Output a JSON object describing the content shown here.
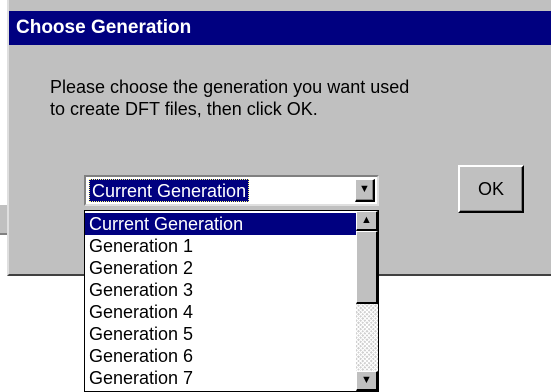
{
  "dialog": {
    "title": "Choose Generation",
    "message": "Please choose the generation you want used\nto create DFT files, then click OK.",
    "ok_label": "OK"
  },
  "combo": {
    "selected_value": "Current Generation",
    "options": [
      "Current Generation",
      "Generation 1",
      "Generation 2",
      "Generation 3",
      "Generation 4",
      "Generation 5",
      "Generation 6",
      "Generation 7"
    ],
    "highlighted_index": 0
  },
  "icons": {
    "combo_arrow": "triangle-down-icon",
    "scroll_up": "triangle-up-icon",
    "scroll_down": "triangle-down-icon"
  },
  "colors": {
    "titlebar": "#000080",
    "dialog_face": "#c0c0c0",
    "selection": "#000080"
  }
}
